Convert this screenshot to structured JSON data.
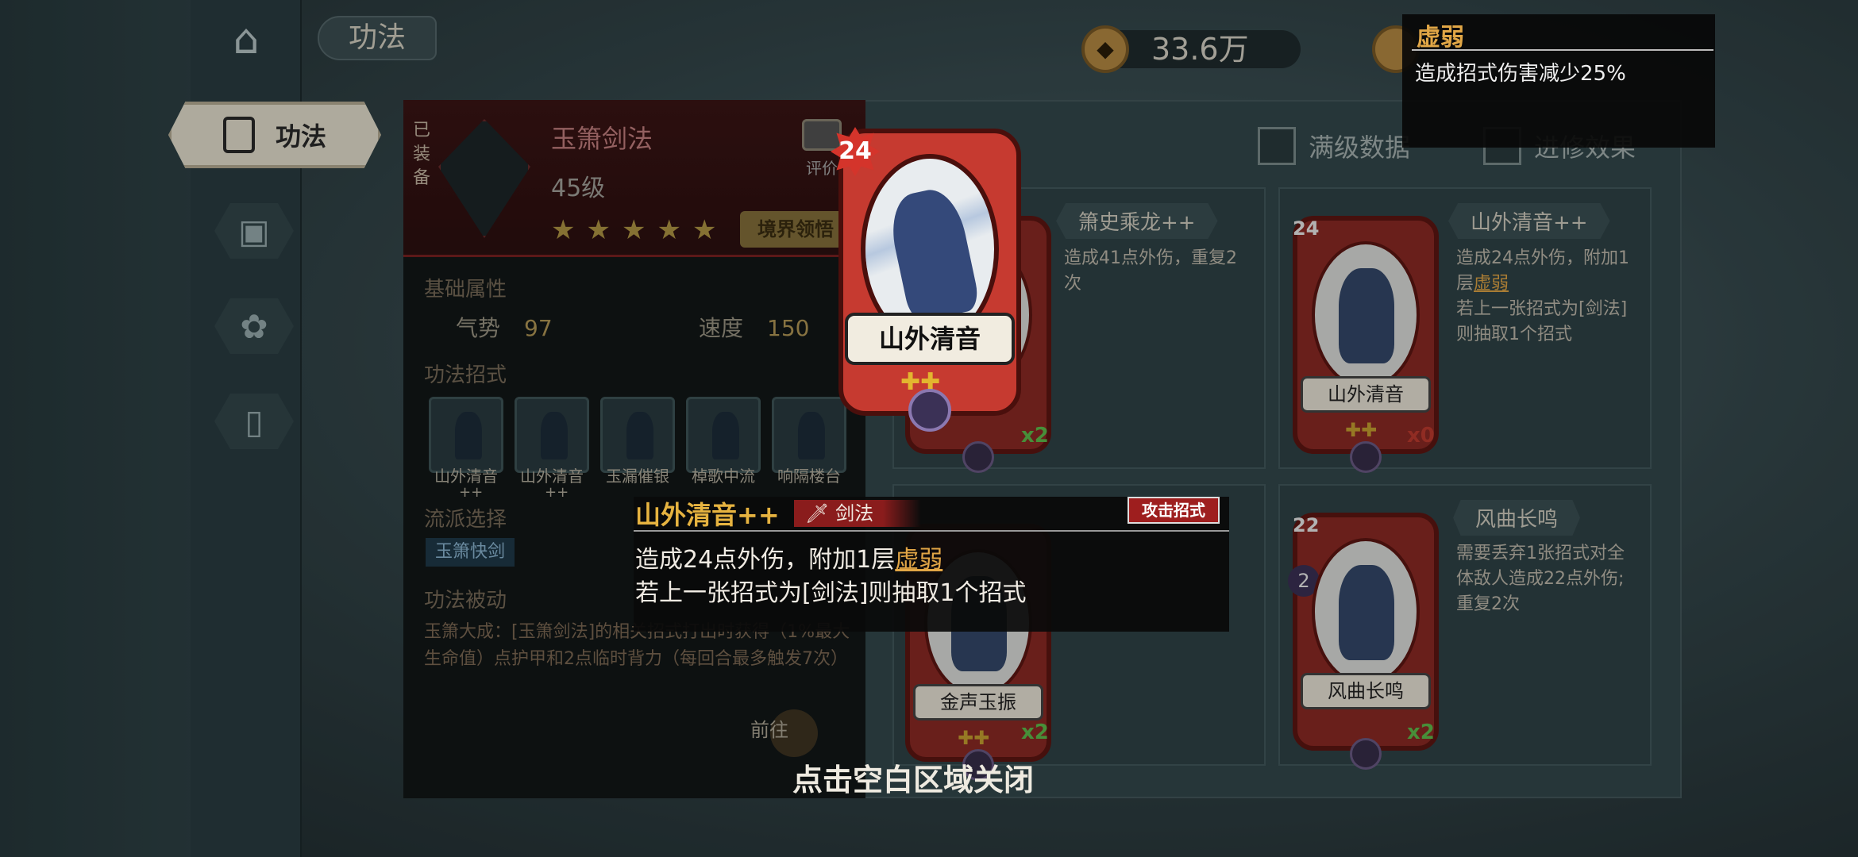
{
  "header": {
    "page_title": "功法",
    "coins": "33.6万",
    "coin_icon": "coin-icon",
    "second_currency_icon": "coin-icon"
  },
  "nav": {
    "active_label": "功法",
    "items": [
      "book-cards-icon",
      "card-box-icon",
      "lotus-icon",
      "card-single-icon"
    ]
  },
  "equipped": {
    "tag": "已装备",
    "name": "玉箫剑法",
    "level": "45级",
    "stars": [
      "★",
      "★",
      "★",
      "★",
      "★"
    ],
    "realm_button": "境界领悟",
    "rate_label": "评价"
  },
  "sections": {
    "base_attrs": "基础属性",
    "moves": "功法招式",
    "school": "流派选择",
    "passive": "功法被动"
  },
  "stats": [
    {
      "label": "气势",
      "value": "97"
    },
    {
      "label": "速度",
      "value": "150"
    }
  ],
  "moves": [
    "山外清音",
    "山外清音",
    "玉漏催银",
    "棹歌中流",
    "响隔楼台"
  ],
  "move_suffixes": [
    "++",
    "++"
  ],
  "school_tag": "玉箫快剑",
  "passive_text": "玉箫大成：[玉箫剑法]的相关招式打出时获得（1%最大生命值）点护甲和2点临时背力（每回合最多触发7次）",
  "goto_label": "前往",
  "filters": {
    "max_level": "满级数据",
    "advance": "进修效果"
  },
  "cards": [
    {
      "title": "箫史乘龙++",
      "desc": "造成41点外伤，重复2次",
      "count": "x2",
      "card_name": "",
      "cost": ""
    },
    {
      "title": "山外清音++",
      "desc_1": "造成24点外伤，附加1层",
      "desc_link": "虚弱",
      "desc_2": "若上一张招式为[剑法]则抽取1个招式",
      "count": "x0",
      "card_name": "山外清音",
      "cost": "24"
    },
    {
      "title": "",
      "desc": "",
      "count": "x2",
      "card_name": "金声玉振",
      "cost": ""
    },
    {
      "title": "风曲长鸣",
      "desc": "需要丢弃1张招式对全体敌人造成22点外伤;重复2次",
      "count": "x2",
      "card_name": "风曲长鸣",
      "cost": "22",
      "secondary_cost": "2"
    }
  ],
  "selected_card": {
    "cost": "24",
    "name": "山外清音",
    "upgrade": "✚✚"
  },
  "tooltip": {
    "name": "山外清音++",
    "type": "剑法",
    "tag": "攻击招式",
    "line1_prefix": "造成24点外伤，附加1层",
    "line1_link": "虚弱",
    "line2": "若上一张招式为[剑法]则抽取1个招式"
  },
  "status_tip": {
    "title": "虚弱",
    "desc": "造成招式伤害减少25%"
  },
  "close_hint": "点击空白区域关闭"
}
